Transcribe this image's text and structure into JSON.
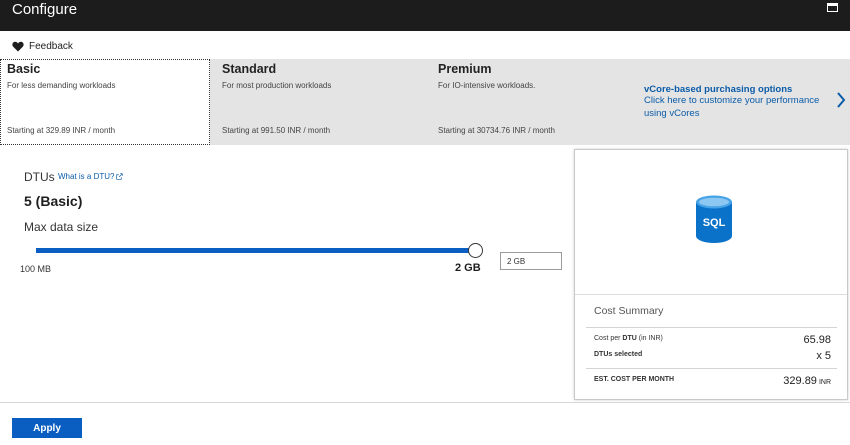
{
  "window": {
    "title": "Configure"
  },
  "feedback": {
    "label": "Feedback"
  },
  "tiers": [
    {
      "name": "Basic",
      "description": "For less demanding workloads",
      "price": "Starting at 329.89 INR / month",
      "selected": true
    },
    {
      "name": "Standard",
      "description": "For most production workloads",
      "price": "Starting at 991.50 INR / month",
      "selected": false
    },
    {
      "name": "Premium",
      "description": "For IO-intensive workloads.",
      "price": "Starting at 30734.76 INR / month",
      "selected": false
    }
  ],
  "vcore": {
    "title": "vCore-based purchasing options",
    "line1": "Click here to customize your performance",
    "line2": "using vCores"
  },
  "dtus": {
    "label": "DTUs",
    "help_link": "What is a DTU?",
    "value": "5 (Basic)"
  },
  "max_data_size": {
    "label": "Max data size",
    "min_label": "100 MB",
    "max_label": "2 GB",
    "input_value": "2 GB",
    "slider_fraction": 1.0
  },
  "cost_summary": {
    "icon_text": "SQL",
    "title": "Cost Summary",
    "cost_per_dtu_label_pre": "Cost per ",
    "cost_per_dtu_label_bold": "DTU",
    "cost_per_dtu_label_post": " (in INR)",
    "cost_per_dtu_value": "65.98",
    "dtus_selected_label": "DTUs selected",
    "dtus_selected_value": "x 5",
    "total_label": "EST. COST PER MONTH",
    "total_value": "329.89",
    "total_unit": "INR"
  },
  "apply": {
    "label": "Apply"
  },
  "colors": {
    "accent": "#0a5ec1",
    "link": "#0b5ca8",
    "titlebar": "#1c1c1c",
    "tier_band": "#e4e4e4"
  }
}
